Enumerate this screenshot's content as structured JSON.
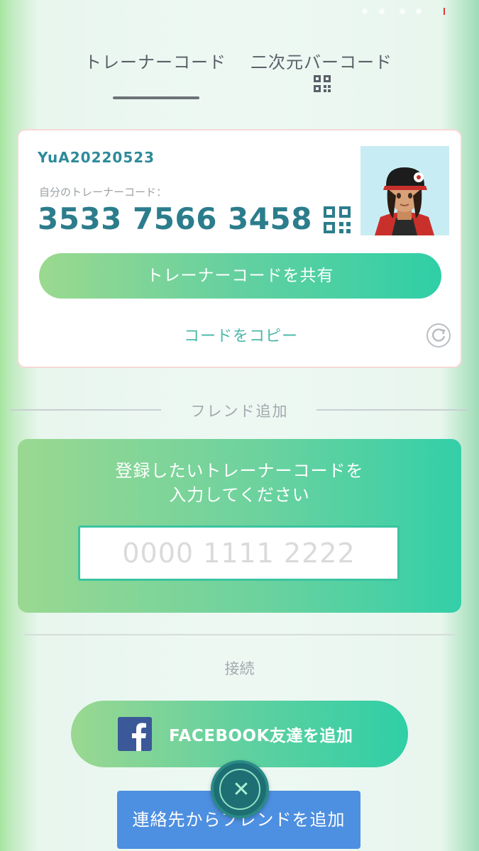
{
  "tabs": {
    "trainer_code": "トレーナーコード",
    "qr_code": "二次元バーコード",
    "qr_icon": "qr-code-icon"
  },
  "profile": {
    "username": "YuA20220523",
    "code_label": "自分のトレーナーコード：",
    "trainer_code": "3533 7566 3458",
    "share_button": "トレーナーコードを共有",
    "copy_link": "コードをコピー",
    "refresh_icon": "refresh-icon",
    "avatar": "trainer-avatar"
  },
  "friend_add": {
    "section_title": "フレンド追加",
    "prompt_line1": "登録したいトレーナーコードを",
    "prompt_line2": "入力してください",
    "input_placeholder": "0000 1111 2222",
    "input_value": ""
  },
  "connect": {
    "label": "接続",
    "facebook_button": "FACEBOOK友達を追加",
    "contacts_button": "連絡先からフレンドを追加",
    "close_icon": "close-icon",
    "close_glyph": "✕"
  },
  "colors": {
    "accent_teal": "#2c7d8c",
    "button_green_start": "#9bd98f",
    "button_green_end": "#2fcfa6",
    "contacts_blue": "#4d8fe0",
    "facebook_blue": "#3b5998"
  }
}
